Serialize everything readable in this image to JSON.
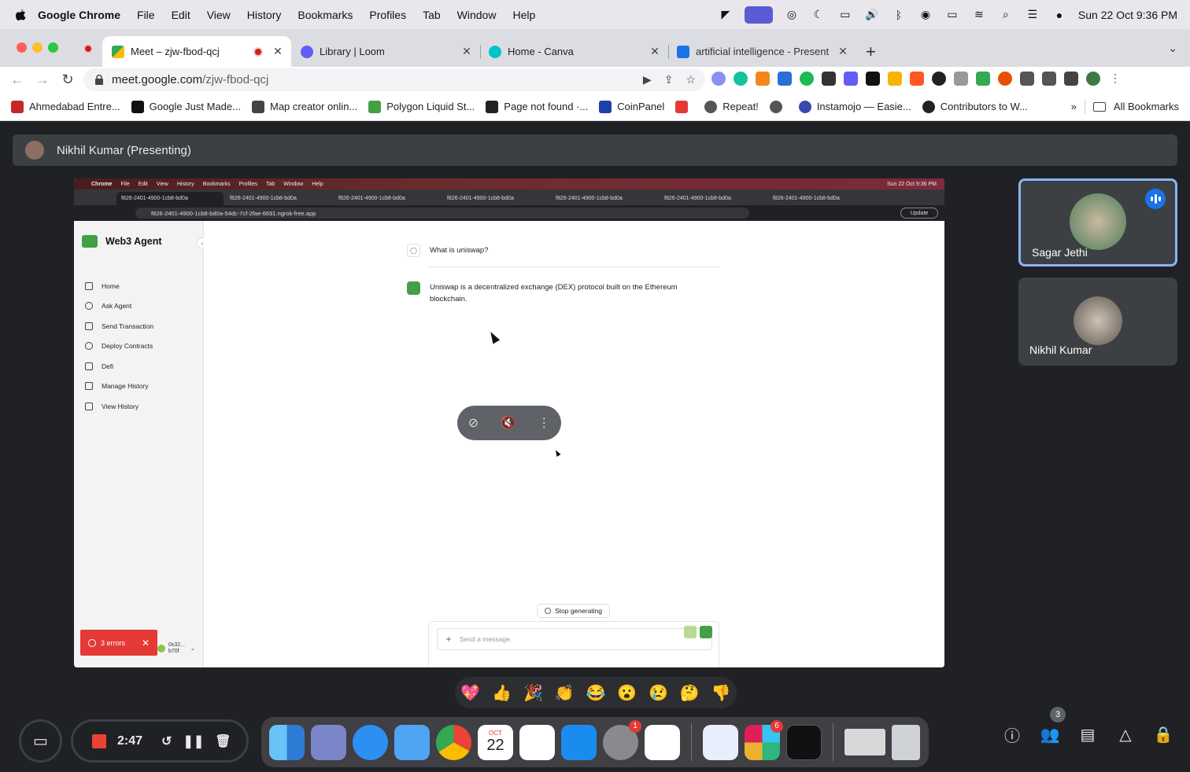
{
  "menubar": {
    "app_name": "Google Chrome",
    "items": [
      "File",
      "Edit",
      "View",
      "History",
      "Bookmarks",
      "Profiles",
      "Tab",
      "Window",
      "Help"
    ],
    "clock": "Sun 22 Oct  9:36 PM"
  },
  "tabs": [
    {
      "title": "Meet – zjw-fbod-qcj",
      "active": true,
      "recording": true
    },
    {
      "title": "Library | Loom",
      "active": false
    },
    {
      "title": "Home - Canva",
      "active": false
    },
    {
      "title": "artificial intelligence - Present",
      "active": false
    }
  ],
  "toolbar": {
    "url_host": "meet.google.com",
    "url_path": "/zjw-fbod-qcj"
  },
  "bookmarks": [
    {
      "label": "Ahmedabad Entre...",
      "color": "#c62828"
    },
    {
      "label": "Google Just Made...",
      "color": "#111111"
    },
    {
      "label": "Map creator onlin...",
      "color": "#444444"
    },
    {
      "label": "Polygon Liquid St...",
      "color": "#43a047"
    },
    {
      "label": "Page not found ·...",
      "color": "#222222"
    },
    {
      "label": "CoinPanel",
      "color": "#1e40af"
    },
    {
      "label": "",
      "color": "#e53935"
    },
    {
      "label": "Repeat!",
      "color": "#555555"
    },
    {
      "label": "",
      "color": "#555555"
    },
    {
      "label": "Instamojo — Easie...",
      "color": "#3949ab"
    },
    {
      "label": "Contributors to W...",
      "color": "#222222"
    }
  ],
  "bookmarks_more": "»",
  "all_bookmarks": "All Bookmarks",
  "meet": {
    "presenter_label": "Nikhil Kumar (Presenting)",
    "participants": [
      {
        "name": "Sagar Jethi",
        "speaking": true
      },
      {
        "name": "Nikhil Kumar",
        "speaking": false
      }
    ],
    "participant_count": "3",
    "reactions": [
      "💖",
      "👍",
      "🎉",
      "👏",
      "😂",
      "😮",
      "😢",
      "🤔",
      "👎"
    ],
    "recording_time": "2:47"
  },
  "shared": {
    "menubar": [
      "Chrome",
      "File",
      "Edit",
      "View",
      "History",
      "Bookmarks",
      "Profiles",
      "Tab",
      "Window",
      "Help"
    ],
    "clock": "Sun 22 Oct  9:36 PM",
    "tab_title": "f826-2401-4900-1cb8-bd0a",
    "url": "f826-2401-4900-1cb8-bd0a-54dc-7cf-2fae-6691.ngrok-free.app",
    "update_label": "Update",
    "brand": "Web3 Agent",
    "nav": [
      "Home",
      "Ask Agent",
      "Send Transaction",
      "Deploy Contracts",
      "Defi",
      "Manage History",
      "View History"
    ],
    "question": "What is uniswap?",
    "answer": "Uniswap is a decentralized exchange (DEX) protocol built on the Ethereum blockchain.",
    "stop_label": "Stop generating",
    "composer_placeholder": "Send a message.",
    "errors_label": "3 errors",
    "wallet": "0x32... b70f"
  },
  "dock_calendar": {
    "month": "OCT",
    "day": "22"
  },
  "dock_badges": {
    "settings": "1",
    "slack": "6"
  }
}
